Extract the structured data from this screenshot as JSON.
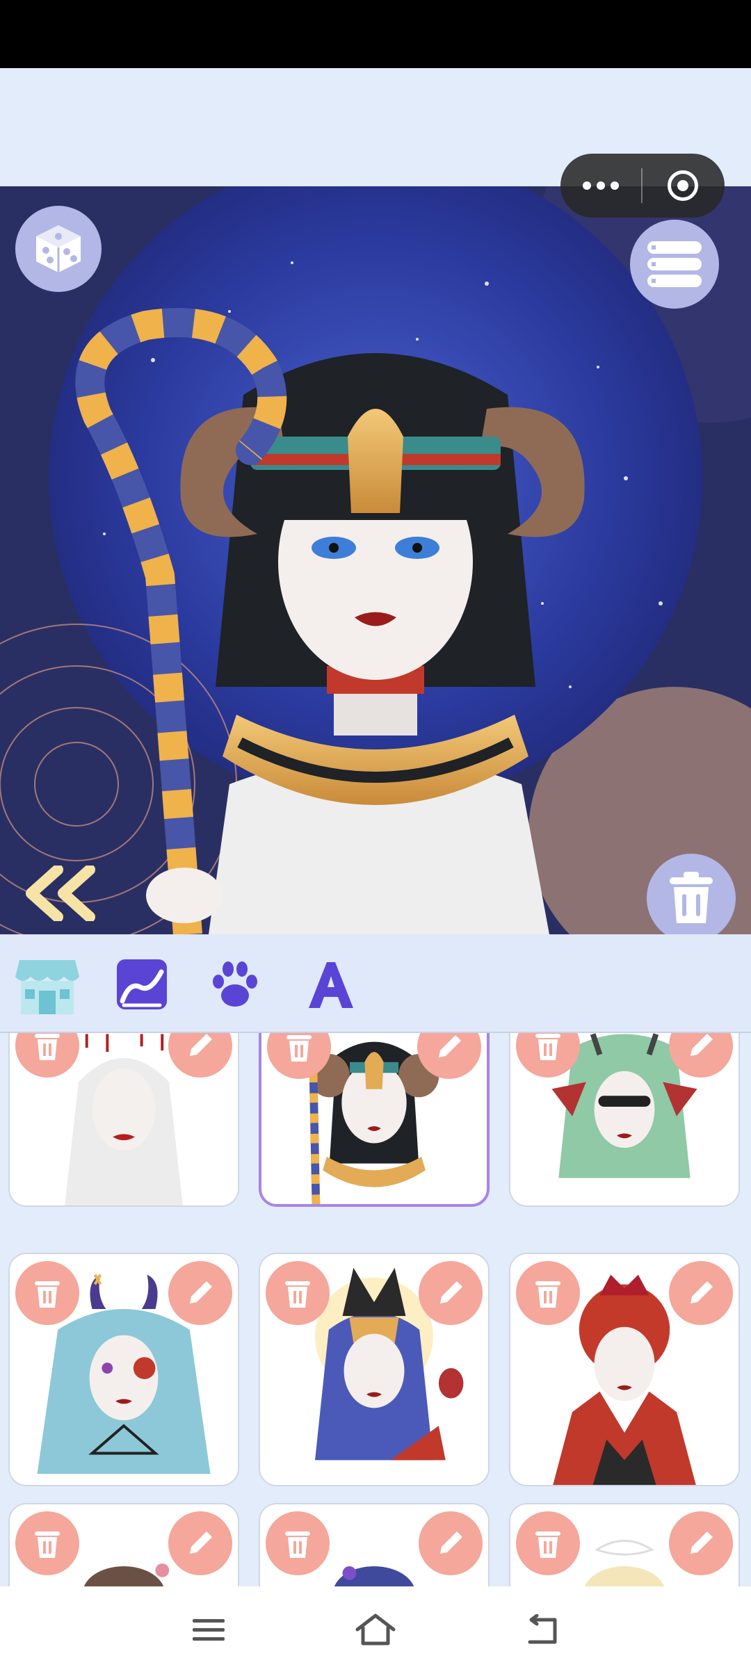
{
  "app": {
    "accent": "#a784e8",
    "button_bg": "#b3b7e6",
    "card_action_color": "#f4a79a",
    "toolbar_icon_color": "#5a44d6"
  },
  "preview": {
    "icons": {
      "randomize": "dice-icon",
      "menu": "list-menu-icon",
      "collapse": "double-chevron-left-icon",
      "delete": "trash-icon"
    }
  },
  "capsule": {
    "more_icon": "more-dots-icon",
    "close_icon": "close-circle-icon"
  },
  "toolbar": {
    "tabs": [
      {
        "icon": "shop-icon",
        "active": true
      },
      {
        "icon": "background-image-icon",
        "active": false
      },
      {
        "icon": "paw-icon",
        "active": false
      },
      {
        "icon": "text-a-icon",
        "active": false
      }
    ]
  },
  "gallery": {
    "cards": [
      {
        "theme": "white-veil",
        "selected": false
      },
      {
        "theme": "egyptian-queen",
        "selected": true
      },
      {
        "theme": "green-demon",
        "selected": false
      },
      {
        "theme": "blue-horned",
        "selected": false
      },
      {
        "theme": "anubis-mask",
        "selected": false
      },
      {
        "theme": "red-queen",
        "selected": false
      },
      {
        "theme": "brown-hair",
        "selected": false
      },
      {
        "theme": "serpent-blue",
        "selected": false
      },
      {
        "theme": "blonde-bow",
        "selected": false
      }
    ]
  },
  "navbar": {
    "icons": [
      "menu-lines-icon",
      "home-icon",
      "back-icon"
    ]
  }
}
